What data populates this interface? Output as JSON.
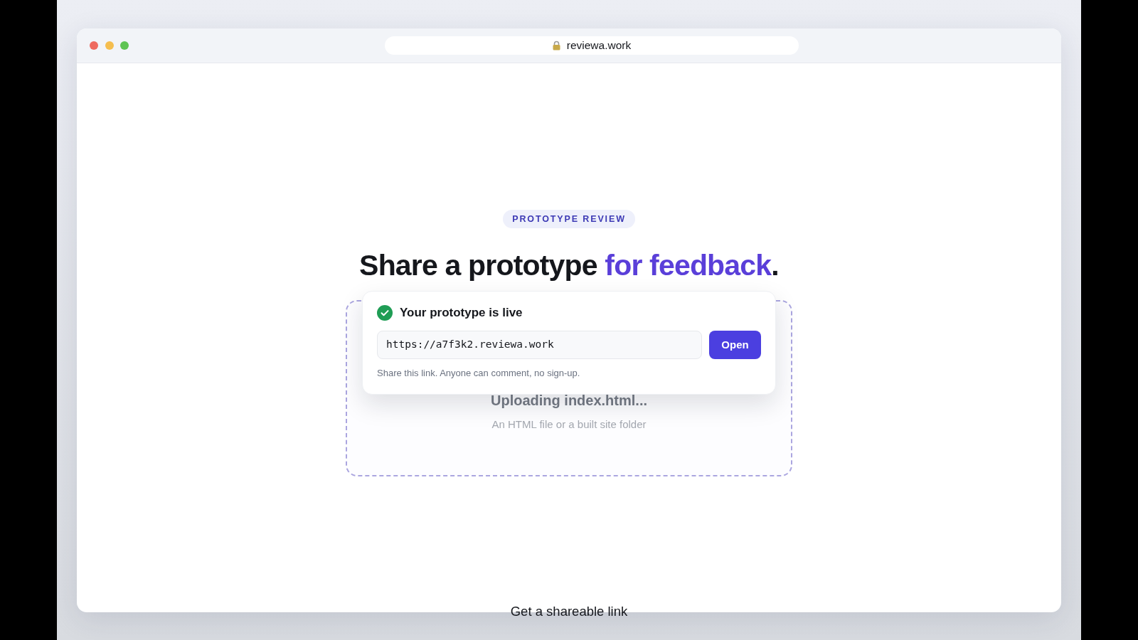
{
  "browser": {
    "address": "reviewa.work"
  },
  "badge": "PROTOTYPE REVIEW",
  "heading": [
    {
      "text": "Share a prototype ",
      "accent": false
    },
    {
      "text": "for feedback",
      "accent": true
    },
    {
      "text": ".",
      "accent": false
    }
  ],
  "share_card": {
    "status": "Your prototype is live",
    "url": "https://a7f3k2.reviewa.work",
    "button": "Open",
    "hint": "Share this link. Anyone can comment, no sign-up."
  },
  "drop_zone": {
    "status": "Uploading index.html...",
    "hint": "An HTML file or a built site folder"
  },
  "caption": "Get a shareable link"
}
